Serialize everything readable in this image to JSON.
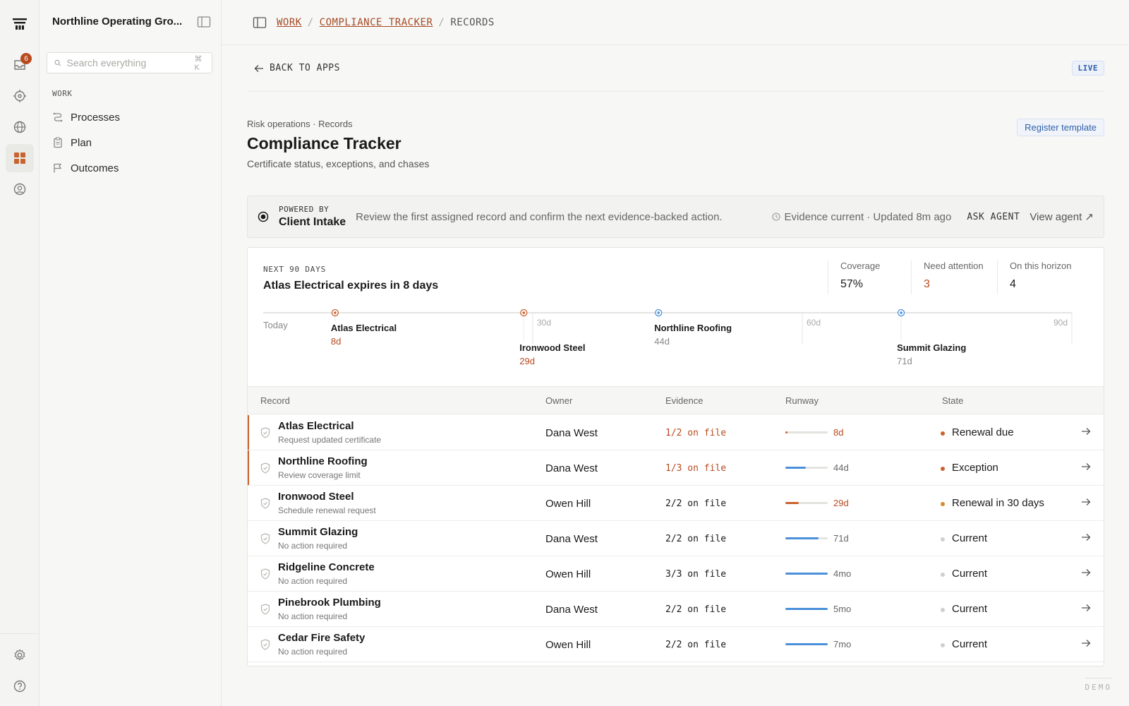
{
  "rail": {
    "inbox_badge": "6",
    "icons": [
      "inbox-icon",
      "target-icon",
      "globe-icon",
      "apps-grid-icon",
      "user-circle-icon",
      "gear-icon",
      "help-icon"
    ]
  },
  "sidebar": {
    "org_name": "Northline Operating Gro...",
    "search_placeholder": "Search everything",
    "search_shortcut": "⌘ K",
    "section_label": "WORK",
    "items": [
      {
        "label": "Processes",
        "icon": "route-icon"
      },
      {
        "label": "Plan",
        "icon": "clipboard-icon"
      },
      {
        "label": "Outcomes",
        "icon": "flag-icon"
      }
    ]
  },
  "breadcrumb": {
    "items": [
      "WORK",
      "COMPLIANCE TRACKER",
      "RECORDS"
    ],
    "separator": "/"
  },
  "header": {
    "back_label": "BACK TO APPS",
    "live_label": "LIVE",
    "eyebrow": "Risk operations · Records",
    "title": "Compliance Tracker",
    "subtitle": "Certificate status, exceptions, and chases",
    "register_button": "Register template"
  },
  "agent": {
    "powered_by_label": "POWERED BY",
    "name": "Client Intake",
    "message": "Review the first assigned record and confirm the next evidence-backed action.",
    "status": "Evidence current · Updated 8m ago",
    "ask_label": "ASK AGENT",
    "view_label": "View agent ↗"
  },
  "timeline": {
    "label": "NEXT 90 DAYS",
    "headline": "Atlas Electrical expires in 8 days",
    "metrics": [
      {
        "label": "Coverage",
        "value": "57%",
        "warn": false
      },
      {
        "label": "Need attention",
        "value": "3",
        "warn": true
      },
      {
        "label": "On this horizon",
        "value": "4",
        "warn": false
      }
    ],
    "axis": {
      "min_days": 0,
      "max_days": 90,
      "start_label": "Today",
      "ticks": [
        {
          "days": 30,
          "label": "30d"
        },
        {
          "days": 60,
          "label": "60d"
        },
        {
          "days": 90,
          "label": "90d"
        }
      ]
    },
    "events": [
      {
        "name": "Atlas Electrical",
        "days": 8,
        "label": "8d",
        "status": "warn",
        "row": 0
      },
      {
        "name": "Ironwood Steel",
        "days": 29,
        "label": "29d",
        "status": "warn",
        "row": 1
      },
      {
        "name": "Northline Roofing",
        "days": 44,
        "label": "44d",
        "status": "ok",
        "row": 0
      },
      {
        "name": "Summit Glazing",
        "days": 71,
        "label": "71d",
        "status": "ok",
        "row": 1
      }
    ]
  },
  "table": {
    "columns": [
      "Record",
      "Owner",
      "Evidence",
      "Runway",
      "State"
    ],
    "rows": [
      {
        "name": "Atlas Electrical",
        "sub": "Request updated certificate",
        "owner": "Dana West",
        "evidence": "1/2 on file",
        "evidence_warn": true,
        "runway": "8d",
        "runway_fraction": 0.05,
        "runway_color": "#c8632f",
        "runway_warn": true,
        "state": "Renewal due",
        "state_color": "#c8632f",
        "flag": true
      },
      {
        "name": "Northline Roofing",
        "sub": "Review coverage limit",
        "owner": "Dana West",
        "evidence": "1/3 on file",
        "evidence_warn": true,
        "runway": "44d",
        "runway_fraction": 0.48,
        "runway_color": "#4a90d9",
        "runway_warn": false,
        "state": "Exception",
        "state_color": "#c8632f",
        "flag": true
      },
      {
        "name": "Ironwood Steel",
        "sub": "Schedule renewal request",
        "owner": "Owen Hill",
        "evidence": "2/2 on file",
        "evidence_warn": false,
        "runway": "29d",
        "runway_fraction": 0.32,
        "runway_color": "#c8632f",
        "runway_warn": true,
        "state": "Renewal in 30 days",
        "state_color": "#d98a2b",
        "flag": false
      },
      {
        "name": "Summit Glazing",
        "sub": "No action required",
        "owner": "Dana West",
        "evidence": "2/2 on file",
        "evidence_warn": false,
        "runway": "71d",
        "runway_fraction": 0.79,
        "runway_color": "#4a90d9",
        "runway_warn": false,
        "state": "Current",
        "state_color": "#cfcfcb",
        "flag": false
      },
      {
        "name": "Ridgeline Concrete",
        "sub": "No action required",
        "owner": "Owen Hill",
        "evidence": "3/3 on file",
        "evidence_warn": false,
        "runway": "4mo",
        "runway_fraction": 1.0,
        "runway_color": "#4a90d9",
        "runway_warn": false,
        "state": "Current",
        "state_color": "#cfcfcb",
        "flag": false
      },
      {
        "name": "Pinebrook Plumbing",
        "sub": "No action required",
        "owner": "Dana West",
        "evidence": "2/2 on file",
        "evidence_warn": false,
        "runway": "5mo",
        "runway_fraction": 1.0,
        "runway_color": "#4a90d9",
        "runway_warn": false,
        "state": "Current",
        "state_color": "#cfcfcb",
        "flag": false
      },
      {
        "name": "Cedar Fire Safety",
        "sub": "No action required",
        "owner": "Owen Hill",
        "evidence": "2/2 on file",
        "evidence_warn": false,
        "runway": "7mo",
        "runway_fraction": 1.0,
        "runway_color": "#4a90d9",
        "runway_warn": false,
        "state": "Current",
        "state_color": "#cfcfcb",
        "flag": false
      }
    ]
  },
  "footer": {
    "demo_label": "DEMO"
  },
  "colors": {
    "accent": "#b84a1f",
    "link": "#2e5fa8",
    "ok": "#4a90d9",
    "warn": "#c8632f"
  }
}
